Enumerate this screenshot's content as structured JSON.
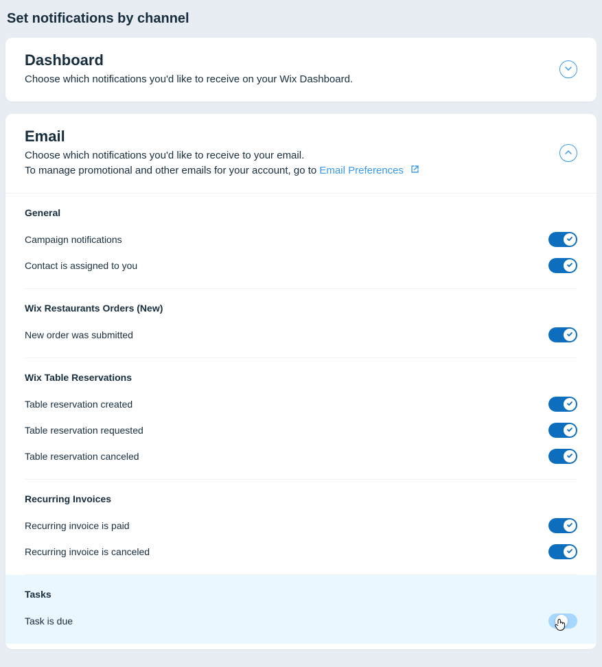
{
  "page": {
    "title": "Set notifications by channel"
  },
  "cards": {
    "dashboard": {
      "title": "Dashboard",
      "desc": "Choose which notifications you'd like to receive on your Wix Dashboard."
    },
    "email": {
      "title": "Email",
      "desc1": "Choose which notifications you'd like to receive to your email.",
      "desc2_prefix": "To manage promotional and other emails for your account, go to ",
      "link": "Email Preferences"
    }
  },
  "sections": [
    {
      "title": "General",
      "items": [
        {
          "label": "Campaign notifications",
          "state": "on"
        },
        {
          "label": "Contact is assigned to you",
          "state": "on"
        }
      ]
    },
    {
      "title": "Wix Restaurants Orders (New)",
      "items": [
        {
          "label": "New order was submitted",
          "state": "on"
        }
      ]
    },
    {
      "title": "Wix Table Reservations",
      "items": [
        {
          "label": "Table reservation created",
          "state": "on"
        },
        {
          "label": "Table reservation requested",
          "state": "on"
        },
        {
          "label": "Table reservation canceled",
          "state": "on"
        }
      ]
    },
    {
      "title": "Recurring Invoices",
      "items": [
        {
          "label": "Recurring invoice is paid",
          "state": "on"
        },
        {
          "label": "Recurring invoice is canceled",
          "state": "on"
        }
      ]
    },
    {
      "title": "Tasks",
      "hovered": true,
      "items": [
        {
          "label": "Task is due",
          "state": "switching",
          "cursor": true
        }
      ]
    }
  ]
}
